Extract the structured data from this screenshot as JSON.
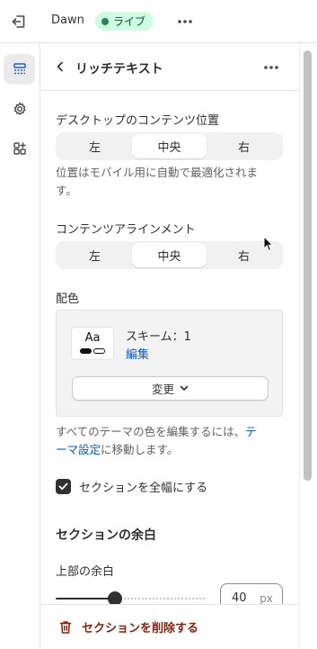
{
  "topbar": {
    "exit_icon": "exit-icon",
    "theme_name": "Dawn",
    "live_badge": "ライブ",
    "more_icon": "more-horizontal-icon"
  },
  "rail": {
    "items": [
      {
        "icon": "sections-icon",
        "active": true
      },
      {
        "icon": "gear-icon",
        "active": false
      },
      {
        "icon": "apps-icon",
        "active": false
      }
    ]
  },
  "panel": {
    "title": "リッチテキスト",
    "desktop_position": {
      "label": "デスクトップのコンテンツ位置",
      "options": [
        "左",
        "中央",
        "右"
      ],
      "selected": "中央",
      "help": "位置はモバイル用に自動で最適化されます。"
    },
    "alignment": {
      "label": "コンテンツアラインメント",
      "options": [
        "左",
        "中央",
        "右"
      ],
      "selected": "中央"
    },
    "color": {
      "label": "配色",
      "swatch_text": "Aa",
      "scheme_name": "スキーム：1",
      "edit_label": "編集",
      "change_label": "変更",
      "help_prefix": "すべてのテーマの色を編集するには、",
      "help_link": "テーマ設定",
      "help_suffix": "に移動します。"
    },
    "full_width": {
      "label": "セクションを全幅にする",
      "checked": true
    },
    "padding": {
      "heading": "セクションの余白",
      "top_label": "上部の余白",
      "top_value": "40",
      "unit": "px",
      "slider_fraction": 0.4
    }
  },
  "footer": {
    "delete_label": "セクションを削除する"
  }
}
